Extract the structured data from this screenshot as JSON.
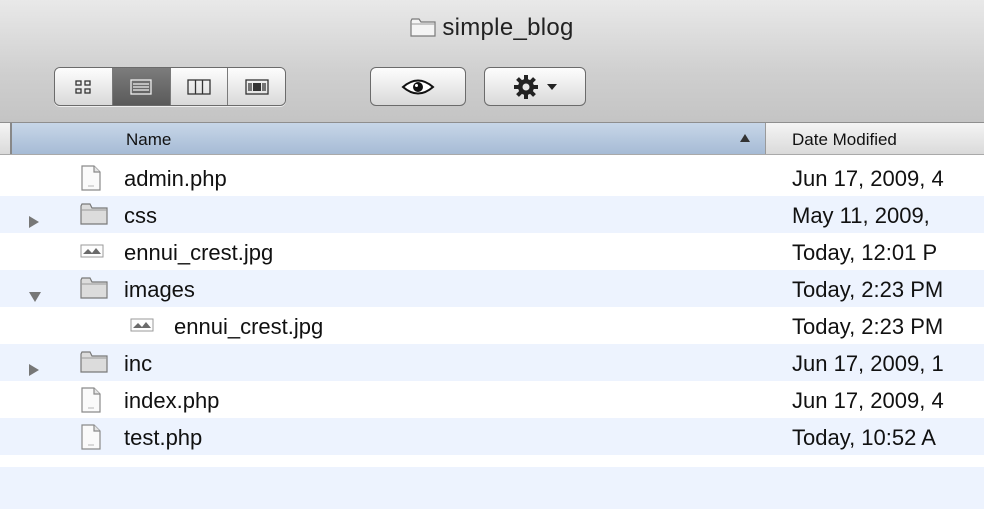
{
  "window": {
    "title": "simple_blog"
  },
  "toolbar": {
    "view_buttons": [
      {
        "name": "icon-view",
        "icon": "grid-icon",
        "active": false
      },
      {
        "name": "list-view",
        "icon": "list-icon",
        "active": true
      },
      {
        "name": "column-view",
        "icon": "columns-icon",
        "active": false
      },
      {
        "name": "coverflow-view",
        "icon": "coverflow-icon",
        "active": false
      }
    ],
    "quicklook_icon": "eye-icon",
    "action_icon": "gear-icon"
  },
  "columns": {
    "name": "Name",
    "date": "Date Modified",
    "sort_icon": "sort-up-icon"
  },
  "files": [
    {
      "name": "admin.php",
      "date": "Jun 17, 2009, 4",
      "kind": "document",
      "disclosure": "none",
      "indent": 0
    },
    {
      "name": "css",
      "date": "May 11, 2009,",
      "kind": "folder",
      "disclosure": "collapsed",
      "indent": 0
    },
    {
      "name": "ennui_crest.jpg",
      "date": "Today, 12:01 P",
      "kind": "image",
      "disclosure": "none",
      "indent": 0
    },
    {
      "name": "images",
      "date": "Today, 2:23 PM",
      "kind": "folder",
      "disclosure": "expanded",
      "indent": 0
    },
    {
      "name": "ennui_crest.jpg",
      "date": "Today, 2:23 PM",
      "kind": "image",
      "disclosure": "none",
      "indent": 1
    },
    {
      "name": "inc",
      "date": "Jun 17, 2009, 1",
      "kind": "folder",
      "disclosure": "collapsed",
      "indent": 0
    },
    {
      "name": "index.php",
      "date": "Jun 17, 2009, 4",
      "kind": "document",
      "disclosure": "none",
      "indent": 0
    },
    {
      "name": "test.php",
      "date": "Today, 10:52 A",
      "kind": "document",
      "disclosure": "none",
      "indent": 0
    }
  ],
  "colors": {
    "row_alt": "#edf3fe",
    "header_selected": "#a6bbd5",
    "toolbar": "#cfcfcf"
  }
}
